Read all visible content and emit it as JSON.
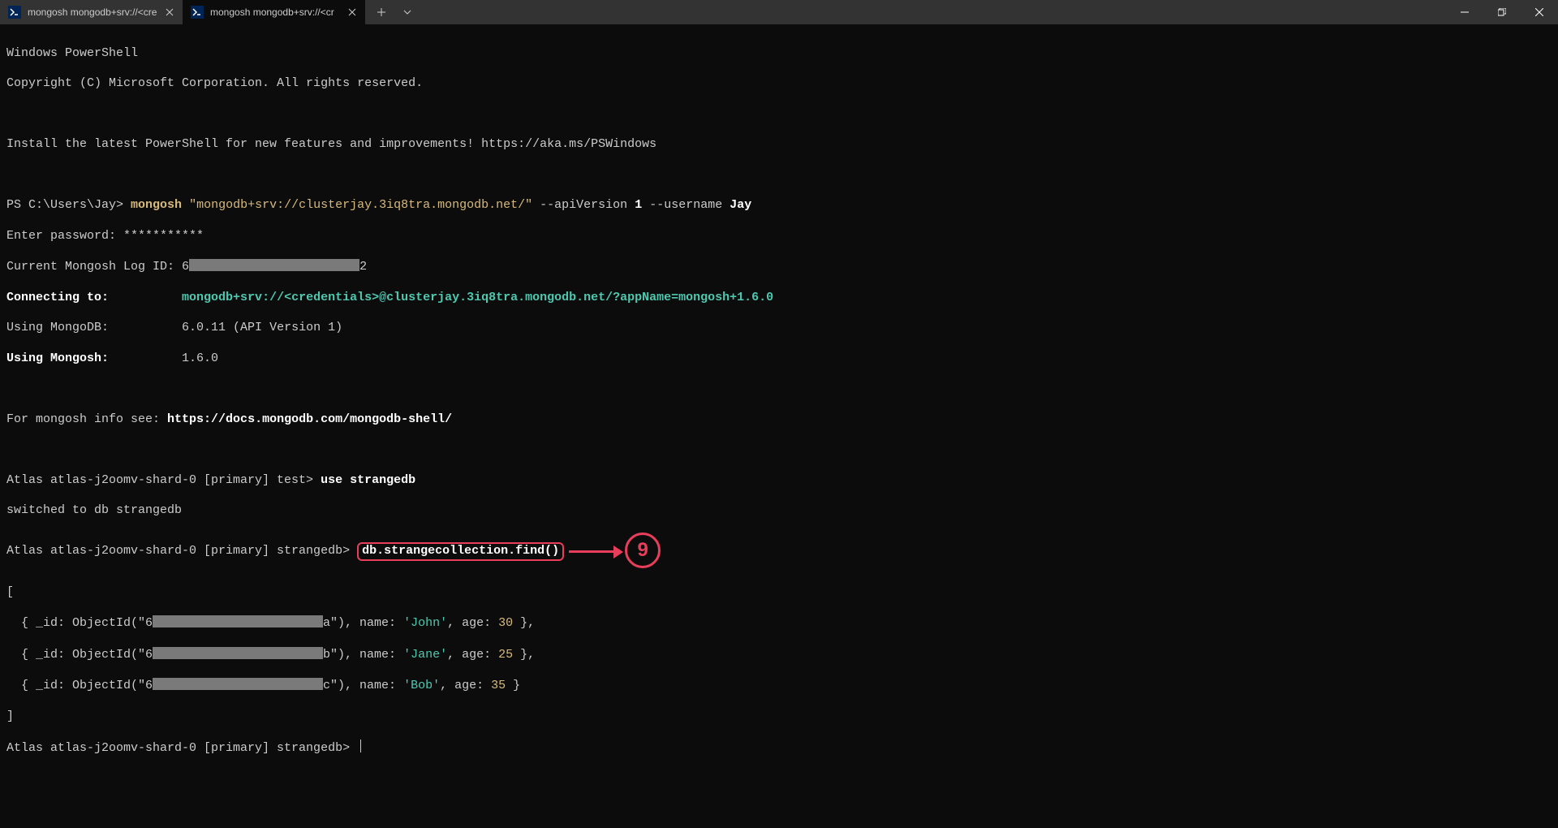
{
  "tabs": [
    {
      "title": "mongosh mongodb+srv://<cre",
      "active": false
    },
    {
      "title": "mongosh mongodb+srv://<cr",
      "active": true
    }
  ],
  "header": {
    "line1": "Windows PowerShell",
    "line2": "Copyright (C) Microsoft Corporation. All rights reserved.",
    "install_msg": "Install the latest PowerShell for new features and improvements! https://aka.ms/PSWindows"
  },
  "ps": {
    "prompt": "PS C:\\Users\\Jay> ",
    "cmd": "mongosh",
    "conn_url": "\"mongodb+srv://clusterjay.3iq8tra.mongodb.net/\"",
    "api_flag": "--apiVersion",
    "api_ver": "1",
    "user_flag": "--username",
    "user": "Jay"
  },
  "enter_pw": "Enter password: ***********",
  "logid_label": "Current Mongosh Log ID: ",
  "logid_prefix": "6",
  "logid_suffix": "2",
  "connecting_label": "Connecting to:",
  "connecting_url": "mongodb+srv://<credentials>@clusterjay.3iq8tra.mongodb.net/?appName=mongosh+1.6.0",
  "using_mongodb_label": "Using MongoDB:",
  "using_mongodb_val": "6.0.11 (API Version 1)",
  "using_mongosh_label": "Using Mongosh:",
  "using_mongosh_val": "1.6.0",
  "info_prefix": "For mongosh info see: ",
  "info_url": "https://docs.mongodb.com/mongodb-shell/",
  "atlas_prompt_test": "Atlas atlas-j2oomv-shard-0 [primary] test> ",
  "use_cmd": "use strangedb",
  "switched": "switched to db strangedb",
  "atlas_prompt_db": "Atlas atlas-j2oomv-shard-0 [primary] strangedb> ",
  "find_cmd": "db.strangecollection.find()",
  "annotation_number": "9",
  "open_bracket": "[",
  "close_bracket": "]",
  "rows": [
    {
      "pre": "  { _id: ObjectId(\"6",
      "suf": "a\"), name: ",
      "name": "'John'",
      "mid1": ", age: ",
      "age": "30",
      "end": " },"
    },
    {
      "pre": "  { _id: ObjectId(\"6",
      "suf": "b\"), name: ",
      "name": "'Jane'",
      "mid1": ", age: ",
      "age": "25",
      "end": " },"
    },
    {
      "pre": "  { _id: ObjectId(\"6",
      "suf": "c\"), name: ",
      "name": "'Bob'",
      "mid1": ", age: ",
      "age": "35",
      "end": " }"
    }
  ],
  "final_prompt": "Atlas atlas-j2oomv-shard-0 [primary] strangedb> "
}
